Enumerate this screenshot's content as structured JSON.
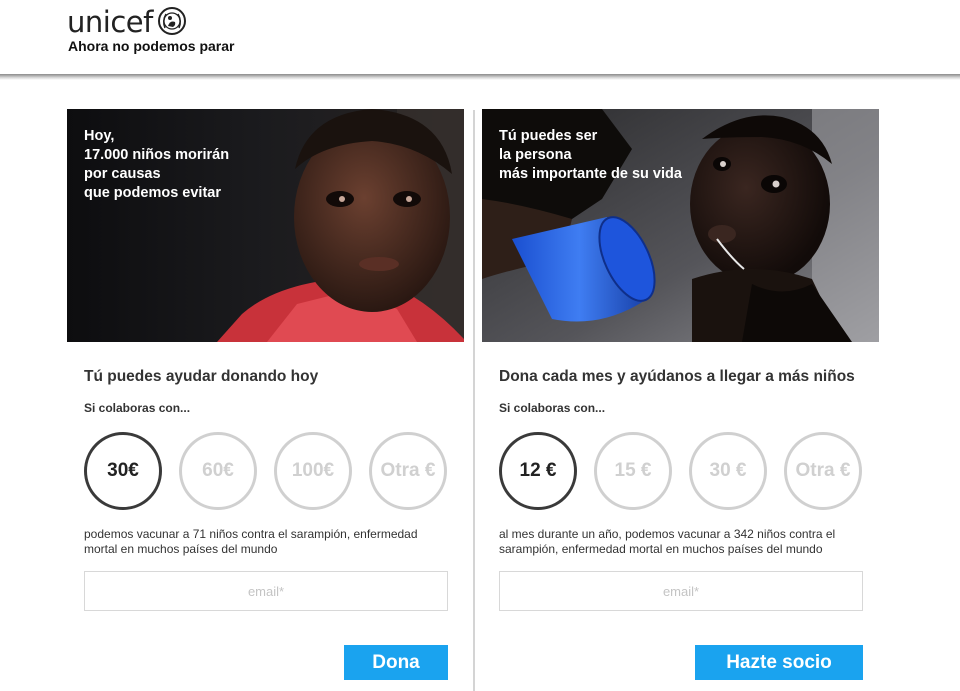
{
  "header": {
    "logo_text": "unicef",
    "tagline": "Ahora no podemos parar"
  },
  "panels": [
    {
      "caption": [
        "Hoy,",
        "17.000 niños morirán",
        "por causas",
        "que podemos evitar"
      ],
      "title": "Tú puedes ayudar donando hoy",
      "collab_label": "Si colaboras con...",
      "amounts": [
        "30€",
        "60€",
        "100€",
        "Otra €"
      ],
      "selected_amount": "30€",
      "description": "podemos vacunar a 71 niños contra el sarampión, enfermedad mortal en muchos países del mundo",
      "email_placeholder": "email*",
      "button_label": "Dona"
    },
    {
      "caption": [
        "Tú puedes ser",
        "la persona",
        "más importante de su vida"
      ],
      "title": "Dona cada mes y ayúdanos a llegar a más niños",
      "collab_label": "Si colaboras con...",
      "amounts": [
        "12 €",
        "15 €",
        "30 €",
        "Otra €"
      ],
      "selected_amount": "12 €",
      "description": "al mes durante un año, podemos vacunar a 342 niños contra el sarampión, enfermedad mortal en muchos países del mundo",
      "email_placeholder": "email*",
      "button_label": "Hazte socio"
    }
  ],
  "colors": {
    "accent": "#1aa3ef",
    "selected_circle": "#3a3a3a",
    "unselected_circle": "#d0d0d0"
  }
}
